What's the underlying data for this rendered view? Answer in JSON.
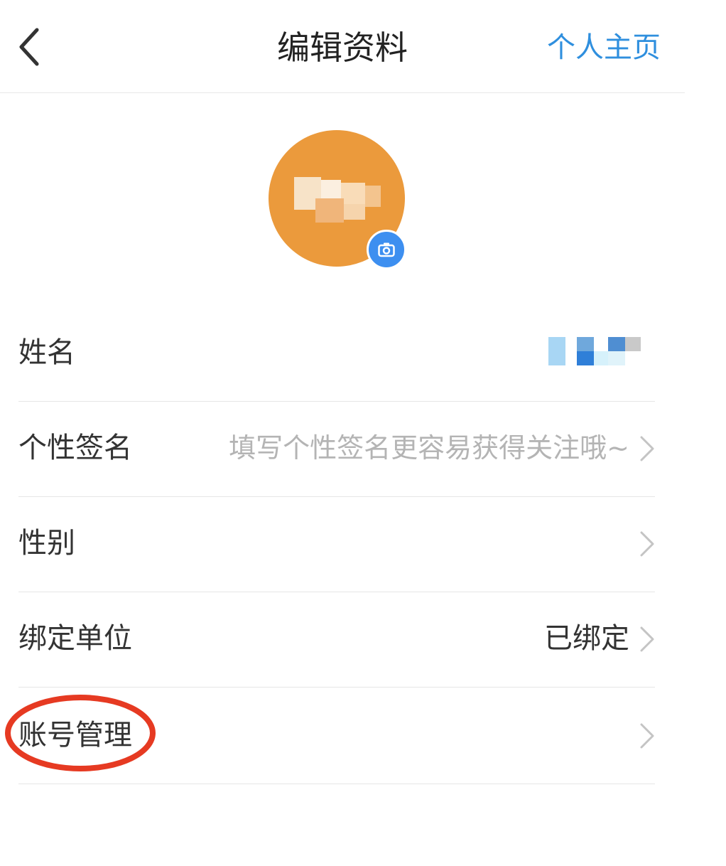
{
  "header": {
    "title": "编辑资料",
    "right_link": "个人主页"
  },
  "colors": {
    "accent": "#2f8fde",
    "avatar_bg": "#eb9a3c",
    "camera_badge": "#3d8ff0",
    "annotation": "#e63a22"
  },
  "icons": {
    "back": "chevron-left-icon",
    "camera": "camera-icon",
    "row_arrow": "chevron-right-icon"
  },
  "rows": [
    {
      "label": "姓名",
      "value": ""
    },
    {
      "label": "个性签名",
      "value": "填写个性签名更容易获得关注哦~"
    },
    {
      "label": "性别",
      "value": ""
    },
    {
      "label": "绑定单位",
      "value": "已绑定"
    },
    {
      "label": "账号管理",
      "value": ""
    }
  ]
}
